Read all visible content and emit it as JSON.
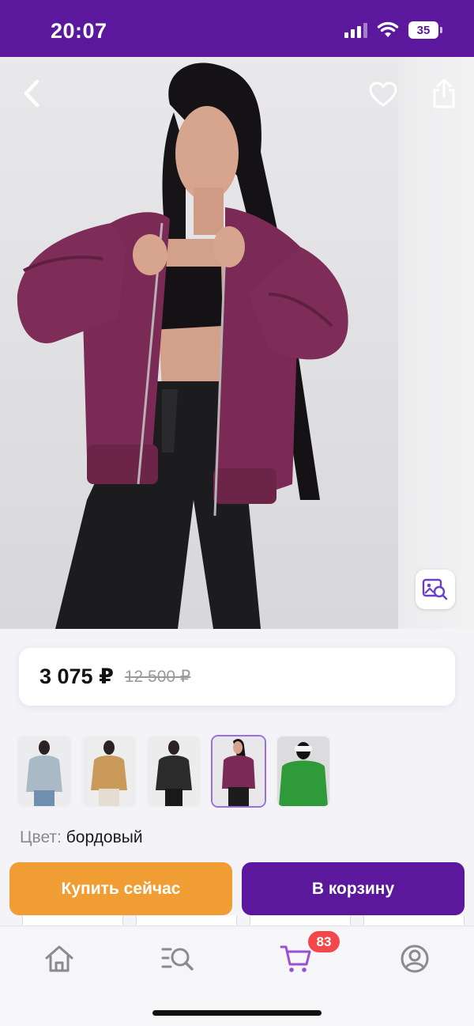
{
  "status_bar": {
    "time": "20:07",
    "battery": "35",
    "background": "#5b189c"
  },
  "photo_controls": {
    "back_icon": "chevron-left-icon",
    "favorite_icon": "heart-icon",
    "share_icon": "share-icon",
    "visual_search_icon": "image-search-icon"
  },
  "price": {
    "current": "3 075 ₽",
    "old": "12 500 ₽"
  },
  "thumbnails": [
    {
      "color": "#a9bac4",
      "selected": false
    },
    {
      "color": "#c99a5a",
      "selected": false
    },
    {
      "color": "#2b2b2b",
      "selected": false
    },
    {
      "color": "#7a2a55",
      "selected": true
    },
    {
      "color": "#2e9a3a",
      "selected": false
    }
  ],
  "color_info": {
    "label": "Цвет:",
    "value": "бордовый"
  },
  "actions": {
    "buy_now": "Купить сейчас",
    "add_to_cart": "В корзину",
    "buy_now_color": "#f09d34",
    "add_to_cart_color": "#5b189c"
  },
  "tab_bar": {
    "items": [
      {
        "icon": "home-icon"
      },
      {
        "icon": "catalog-search-icon"
      },
      {
        "icon": "cart-icon",
        "active": true
      },
      {
        "icon": "profile-icon"
      }
    ],
    "cart_badge": "83",
    "active_color": "#9b4fd6"
  }
}
